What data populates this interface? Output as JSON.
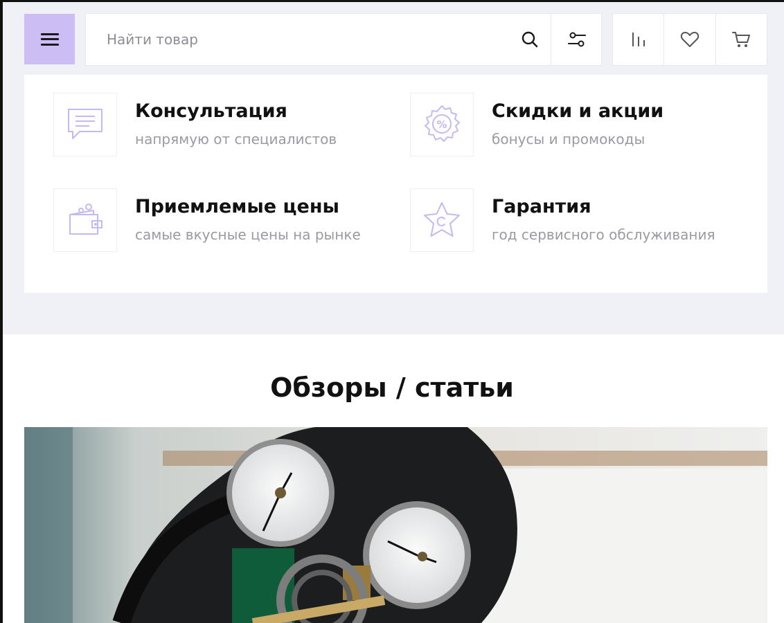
{
  "search": {
    "placeholder": "Найти товар"
  },
  "features": [
    {
      "title": "Консультация",
      "subtitle": "напрямую от специалистов",
      "icon": "chat-icon"
    },
    {
      "title": "Скидки и акции",
      "subtitle": "бонусы и промокоды",
      "icon": "discount-badge-icon"
    },
    {
      "title": "Приемлемые цены",
      "subtitle": "самые вкусные цены на рынке",
      "icon": "wallet-icon"
    },
    {
      "title": "Гарантия",
      "subtitle": "год сервисного обслуживания",
      "icon": "star-icon"
    }
  ],
  "articles": {
    "title": "Обзоры / статьи"
  },
  "colors": {
    "accent": "#cdbdf5",
    "icon_stroke": "#c6b8f2",
    "background": "#eff1f7"
  }
}
